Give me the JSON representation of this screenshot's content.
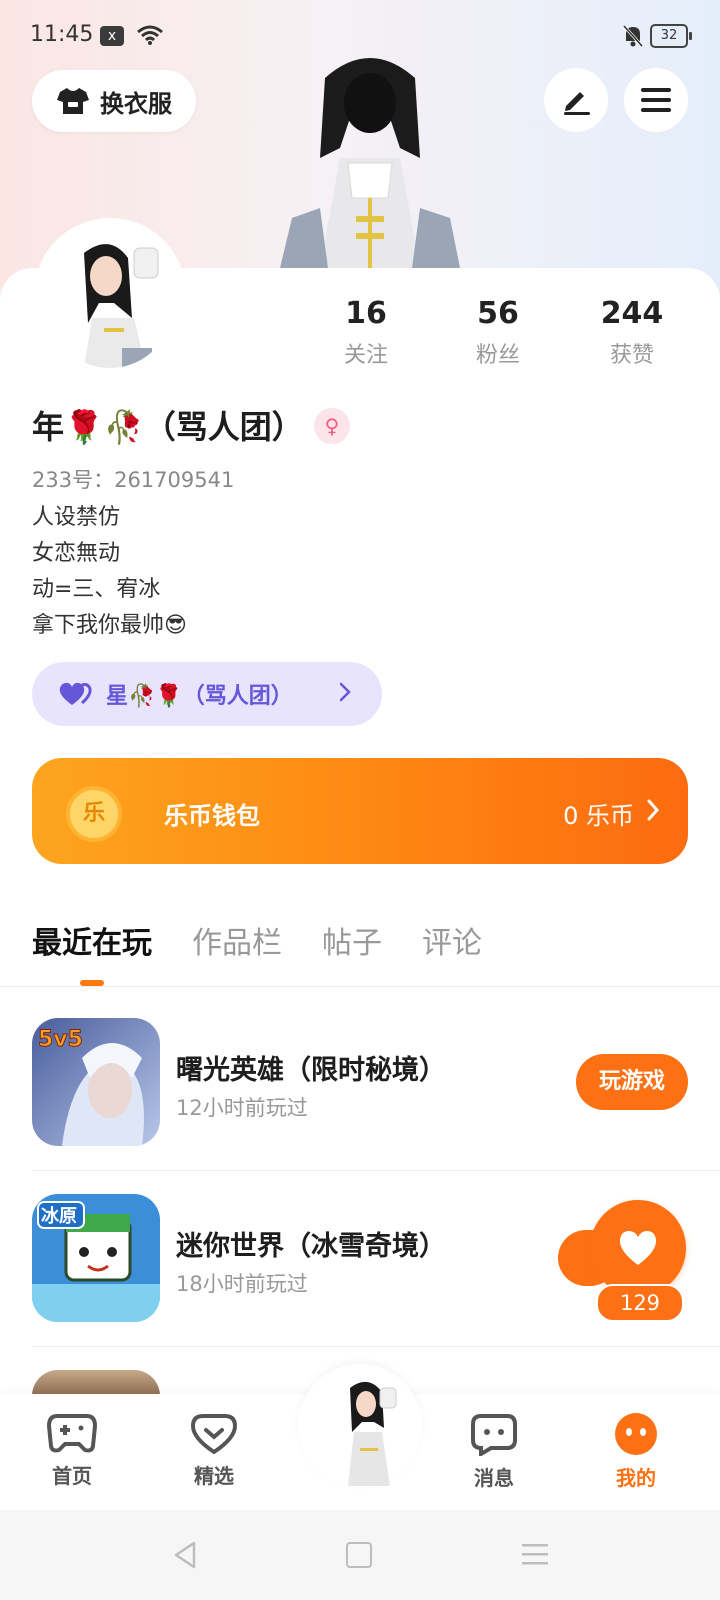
{
  "status_bar": {
    "time": "11:45",
    "battery": "32",
    "notif_icon": "x"
  },
  "header": {
    "dress_button_label": "换衣服"
  },
  "profile": {
    "nickname": "年🌹🥀（骂人团）",
    "uid_text": "233号：261709541",
    "bio_lines": [
      "人设禁仿",
      "女恋無动",
      "动=三、宥冰",
      "拿下我你最帅😎"
    ],
    "stats": [
      {
        "value": "16",
        "label": "关注"
      },
      {
        "value": "56",
        "label": "粉丝"
      },
      {
        "value": "244",
        "label": "获赞"
      }
    ],
    "group_label": "星🥀🌹（骂人团）"
  },
  "wallet": {
    "coin_glyph": "乐",
    "title": "乐币钱包",
    "balance": "0 乐币"
  },
  "tabs": [
    "最近在玩",
    "作品栏",
    "帖子",
    "评论"
  ],
  "recent_games": [
    {
      "name": "曙光英雄（限时秘境）",
      "time": "12小时前玩过",
      "action": "玩游戏",
      "badge": "5v5"
    },
    {
      "name": "迷你世界（冰雪奇境）",
      "time": "18小时前玩过",
      "badge": "冰原"
    }
  ],
  "like": {
    "count": "129"
  },
  "bottom_nav": [
    {
      "label": "首页",
      "icon": "gamepad-icon"
    },
    {
      "label": "精选",
      "icon": "heart-shield-icon"
    },
    {
      "label": "",
      "icon": "avatar-icon"
    },
    {
      "label": "消息",
      "icon": "chat-icon"
    },
    {
      "label": "我的",
      "icon": "face-icon"
    }
  ],
  "colors": {
    "accent": "#fd7013",
    "group_bg": "#e8e4fd",
    "group_text": "#6656d8"
  }
}
